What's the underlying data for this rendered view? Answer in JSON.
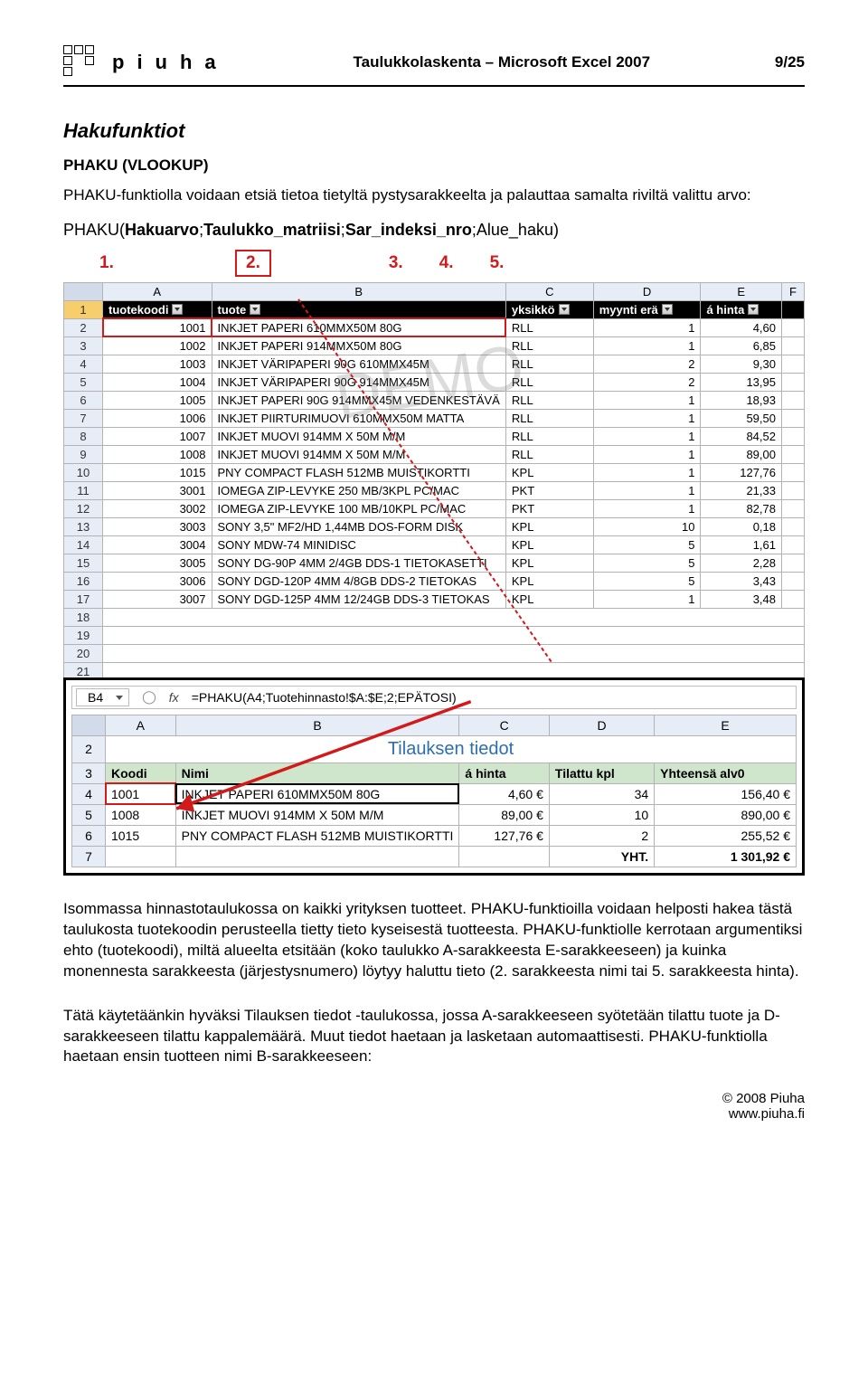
{
  "header": {
    "logo_text": "piuha",
    "doc_title": "Taulukkolaskenta – Microsoft Excel 2007",
    "page": "9/25"
  },
  "h2": "Hakufunktiot",
  "subtitle": "PHAKU (VLOOKUP)",
  "intro": "PHAKU-funktiolla voidaan etsiä tietoa tietyltä pystysarakkeelta ja palauttaa samalta riviltä valittu arvo:",
  "formula": {
    "prefix": "PHAKU(",
    "a1": "Hakuarvo",
    "a2": "Taulukko_matriisi",
    "a3": "Sar_indeksi_nro",
    "a4": "Alue_haku",
    "sep": ";",
    "suffix": ")"
  },
  "nums": {
    "n1": "1.",
    "n2": "2.",
    "n3": "3.",
    "n4": "4.",
    "n5": "5."
  },
  "sheet1": {
    "cols": [
      "A",
      "B",
      "C",
      "D",
      "E",
      "F"
    ],
    "header_row": {
      "A": "tuotekoodi",
      "B": "tuote",
      "C": "yksikkö",
      "D": "myynti erä",
      "E": "á hinta"
    },
    "rows": [
      {
        "n": "2",
        "A": "1001",
        "B": "INKJET PAPERI 610MMX50M 80G",
        "C": "RLL",
        "D": "1",
        "E": "4,60"
      },
      {
        "n": "3",
        "A": "1002",
        "B": "INKJET PAPERI 914MMX50M 80G",
        "C": "RLL",
        "D": "1",
        "E": "6,85"
      },
      {
        "n": "4",
        "A": "1003",
        "B": "INKJET VÄRIPAPERI 90G 610MMX45M",
        "C": "RLL",
        "D": "2",
        "E": "9,30"
      },
      {
        "n": "5",
        "A": "1004",
        "B": "INKJET VÄRIPAPERI 90G 914MMX45M",
        "C": "RLL",
        "D": "2",
        "E": "13,95"
      },
      {
        "n": "6",
        "A": "1005",
        "B": "INKJET PAPERI 90G 914MMX45M VEDENKESTÄVÄ",
        "C": "RLL",
        "D": "1",
        "E": "18,93"
      },
      {
        "n": "7",
        "A": "1006",
        "B": "INKJET PIIRTURIMUOVI 610MMX50M MATTA",
        "C": "RLL",
        "D": "1",
        "E": "59,50"
      },
      {
        "n": "8",
        "A": "1007",
        "B": "INKJET MUOVI 914MM X 50M M/M",
        "C": "RLL",
        "D": "1",
        "E": "84,52"
      },
      {
        "n": "9",
        "A": "1008",
        "B": "INKJET MUOVI 914MM X 50M M/M",
        "C": "RLL",
        "D": "1",
        "E": "89,00"
      },
      {
        "n": "10",
        "A": "1015",
        "B": "PNY COMPACT FLASH 512MB MUISTIKORTTI",
        "C": "KPL",
        "D": "1",
        "E": "127,76"
      },
      {
        "n": "11",
        "A": "3001",
        "B": "IOMEGA ZIP-LEVYKE 250 MB/3KPL PC/MAC",
        "C": "PKT",
        "D": "1",
        "E": "21,33"
      },
      {
        "n": "12",
        "A": "3002",
        "B": "IOMEGA ZIP-LEVYKE 100 MB/10KPL PC/MAC",
        "C": "PKT",
        "D": "1",
        "E": "82,78"
      },
      {
        "n": "13",
        "A": "3003",
        "B": "SONY 3,5\" MF2/HD 1,44MB DOS-FORM DISK",
        "C": "KPL",
        "D": "10",
        "E": "0,18"
      },
      {
        "n": "14",
        "A": "3004",
        "B": "SONY MDW-74 MINIDISC",
        "C": "KPL",
        "D": "5",
        "E": "1,61"
      },
      {
        "n": "15",
        "A": "3005",
        "B": "SONY DG-90P 4MM 2/4GB DDS-1 TIETOKASETTI",
        "C": "KPL",
        "D": "5",
        "E": "2,28"
      },
      {
        "n": "16",
        "A": "3006",
        "B": "SONY DGD-120P 4MM 4/8GB DDS-2 TIETOKAS",
        "C": "KPL",
        "D": "5",
        "E": "3,43"
      },
      {
        "n": "17",
        "A": "3007",
        "B": "SONY DGD-125P 4MM 12/24GB DDS-3 TIETOKAS",
        "C": "KPL",
        "D": "1",
        "E": "3,48"
      }
    ],
    "tail_rows": [
      "18",
      "19",
      "20",
      "21"
    ]
  },
  "fbar": {
    "ref": "B4",
    "fx": "fx",
    "formula": "=PHAKU(A4;Tuotehinnasto!$A:$E;2;EPÄTOSI)"
  },
  "sheet2": {
    "cols": [
      "A",
      "B",
      "C",
      "D",
      "E"
    ],
    "title": "Tilauksen tiedot",
    "headers": {
      "A": "Koodi",
      "B": "Nimi",
      "C": "á hinta",
      "D": "Tilattu kpl",
      "E": "Yhteensä alv0"
    },
    "rows": [
      {
        "n": "4",
        "A": "1001",
        "B": "INKJET PAPERI 610MMX50M 80G",
        "C": "4,60 €",
        "D": "34",
        "E": "156,40 €"
      },
      {
        "n": "5",
        "A": "1008",
        "B": "INKJET MUOVI 914MM X 50M M/M",
        "C": "89,00 €",
        "D": "10",
        "E": "890,00 €"
      },
      {
        "n": "6",
        "A": "1015",
        "B": "PNY COMPACT FLASH 512MB MUISTIKORTTI",
        "C": "127,76 €",
        "D": "2",
        "E": "255,52 €"
      }
    ],
    "total_row": {
      "n": "7",
      "label": "YHT.",
      "value": "1 301,92 €"
    }
  },
  "para1": "Isommassa hinnastotaulukossa on kaikki yrityksen tuotteet. PHAKU-funktioilla voidaan helposti hakea tästä taulukosta tuotekoodin perusteella tietty tieto kyseisestä tuotteesta. PHAKU-funktiolle kerrotaan argumentiksi ehto (tuotekoodi), miltä alueelta etsitään (koko taulukko A-sarakkeesta E-sarakkeeseen) ja kuinka monennesta sarakkeesta (järjestysnumero) löytyy haluttu tieto (2. sarakkeesta nimi tai 5. sarakkeesta hinta).",
  "para2": "Tätä käytetäänkin hyväksi Tilauksen tiedot -taulukossa, jossa A-sarakkeeseen syötetään tilattu tuote ja D-sarakkeeseen tilattu kappalemäärä. Muut tiedot haetaan ja lasketaan automaattisesti. PHAKU-funktiolla haetaan ensin tuotteen nimi B-sarakkeeseen:",
  "footer": {
    "copy": "© 2008 Piuha",
    "url": "www.piuha.fi"
  }
}
